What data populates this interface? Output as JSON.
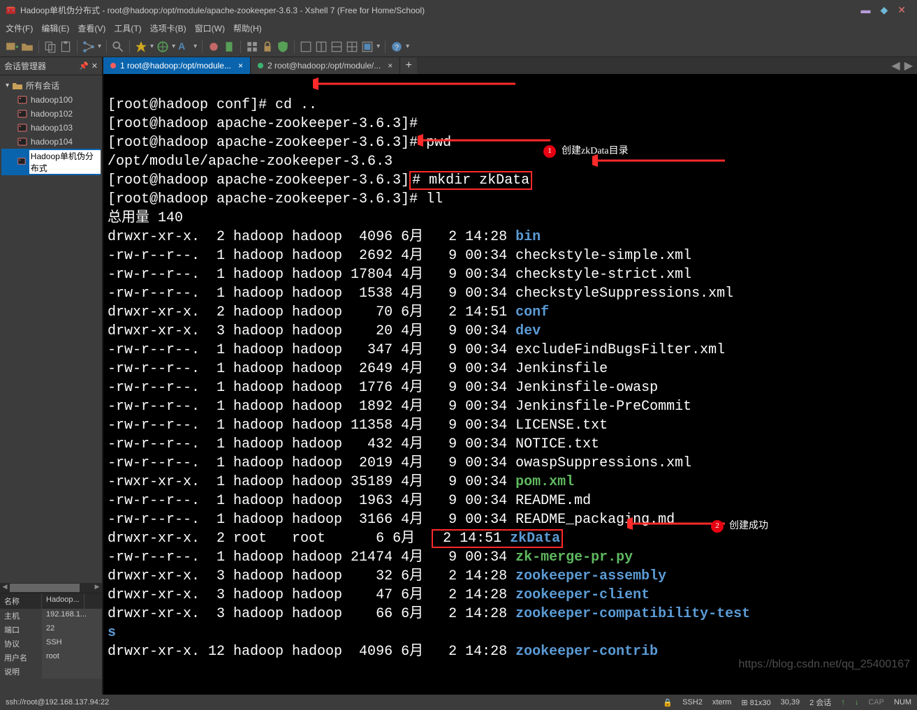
{
  "title": "Hadoop单机伪分布式 - root@hadoop:/opt/module/apache-zookeeper-3.6.3 - Xshell 7 (Free for Home/School)",
  "window_icons": {
    "min": "▬",
    "sq": "◆",
    "close": "✕"
  },
  "menu": [
    "文件(F)",
    "编辑(E)",
    "查看(V)",
    "工具(T)",
    "选项卡(B)",
    "窗口(W)",
    "帮助(H)"
  ],
  "sidebar": {
    "title": "会话管理器",
    "root": "所有会话",
    "items": [
      "hadoop100",
      "hadoop102",
      "hadoop103",
      "hadoop104",
      "Hadoop单机伪分布式"
    ],
    "info_headers": [
      "名称",
      "Hadoop..."
    ],
    "info": [
      {
        "k": "主机",
        "v": "192.168.1..."
      },
      {
        "k": "端口",
        "v": "22"
      },
      {
        "k": "协议",
        "v": "SSH"
      },
      {
        "k": "用户名",
        "v": "root"
      },
      {
        "k": "说明",
        "v": ""
      }
    ]
  },
  "tabs": [
    {
      "label": "1 root@hadoop:/opt/module...",
      "active": true,
      "dot": "#ff5c5c"
    },
    {
      "label": "2 root@hadoop:/opt/module/...",
      "active": false,
      "dot": "#3cb371"
    }
  ],
  "add_tab": "+",
  "terminal": {
    "l1_a": "[root@hadoop conf]# cd ..",
    "l2": "[root@hadoop apache-zookeeper-3.6.3]#",
    "l3": "[root@hadoop apache-zookeeper-3.6.3]# pwd",
    "l4": "/opt/module/apache-zookeeper-3.6.3",
    "l5a": "[root@hadoop apache-zookeeper-3.6.3]",
    "l5b": "# mkdir zkData",
    "l6": "[root@hadoop apache-zookeeper-3.6.3]# ll",
    "l7": "总用量 140",
    "ls": [
      {
        "p": "drwxr-xr-x.  2 hadoop hadoop  4096 6月   2 14:28 ",
        "n": "bin",
        "c": "blue"
      },
      {
        "p": "-rw-r--r--.  1 hadoop hadoop  2692 4月   9 00:34 ",
        "n": "checkstyle-simple.xml",
        "c": ""
      },
      {
        "p": "-rw-r--r--.  1 hadoop hadoop 17804 4月   9 00:34 ",
        "n": "checkstyle-strict.xml",
        "c": ""
      },
      {
        "p": "-rw-r--r--.  1 hadoop hadoop  1538 4月   9 00:34 ",
        "n": "checkstyleSuppressions.xml",
        "c": ""
      },
      {
        "p": "drwxr-xr-x.  2 hadoop hadoop    70 6月   2 14:51 ",
        "n": "conf",
        "c": "blue"
      },
      {
        "p": "drwxr-xr-x.  3 hadoop hadoop    20 4月   9 00:34 ",
        "n": "dev",
        "c": "blue"
      },
      {
        "p": "-rw-r--r--.  1 hadoop hadoop   347 4月   9 00:34 ",
        "n": "excludeFindBugsFilter.xml",
        "c": ""
      },
      {
        "p": "-rw-r--r--.  1 hadoop hadoop  2649 4月   9 00:34 ",
        "n": "Jenkinsfile",
        "c": ""
      },
      {
        "p": "-rw-r--r--.  1 hadoop hadoop  1776 4月   9 00:34 ",
        "n": "Jenkinsfile-owasp",
        "c": ""
      },
      {
        "p": "-rw-r--r--.  1 hadoop hadoop  1892 4月   9 00:34 ",
        "n": "Jenkinsfile-PreCommit",
        "c": ""
      },
      {
        "p": "-rw-r--r--.  1 hadoop hadoop 11358 4月   9 00:34 ",
        "n": "LICENSE.txt",
        "c": ""
      },
      {
        "p": "-rw-r--r--.  1 hadoop hadoop   432 4月   9 00:34 ",
        "n": "NOTICE.txt",
        "c": ""
      },
      {
        "p": "-rw-r--r--.  1 hadoop hadoop  2019 4月   9 00:34 ",
        "n": "owaspSuppressions.xml",
        "c": ""
      },
      {
        "p": "-rwxr-xr-x.  1 hadoop hadoop 35189 4月   9 00:34 ",
        "n": "pom.xml",
        "c": "green"
      },
      {
        "p": "-rw-r--r--.  1 hadoop hadoop  1963 4月   9 00:34 ",
        "n": "README.md",
        "c": ""
      },
      {
        "p": "-rw-r--r--.  1 hadoop hadoop  3166 4月   9 00:34 ",
        "n": "README_packaging.md",
        "c": ""
      }
    ],
    "zk_a": "drwxr-xr-x.  2 root   root      6 6月  ",
    "zk_b": " 2 14:51 ",
    "zk_n": "zkData",
    "ls2": [
      {
        "p": "-rw-r--r--.  1 hadoop hadoop 21474 4月   9 00:34 ",
        "n": "zk-merge-pr.py",
        "c": "green"
      },
      {
        "p": "drwxr-xr-x.  3 hadoop hadoop    32 6月   2 14:28 ",
        "n": "zookeeper-assembly",
        "c": "blue"
      },
      {
        "p": "drwxr-xr-x.  3 hadoop hadoop    47 6月   2 14:28 ",
        "n": "zookeeper-client",
        "c": "blue"
      },
      {
        "p": "drwxr-xr-x.  3 hadoop hadoop    66 6月   2 14:28 ",
        "n": "zookeeper-compatibility-test",
        "c": "blue"
      }
    ],
    "cont": "s",
    "last_a": "drwxr-xr-x. 12 hadoop hadoop  4096 6月   2 14:28 ",
    "last_n": "zookeeper-contrib"
  },
  "annotations": {
    "a1_num": "1",
    "a1_text": "创建zkData目录",
    "a2_num": "2",
    "a2_text": "创建成功"
  },
  "watermark": "https://blog.csdn.net/qq_25400167",
  "status": {
    "left": "ssh://root@192.168.137.94:22",
    "items": [
      "SSH2",
      "xterm",
      "81x30",
      "30,39",
      "2 会话",
      "CAP",
      "NUM"
    ],
    "lock": "🔒"
  }
}
